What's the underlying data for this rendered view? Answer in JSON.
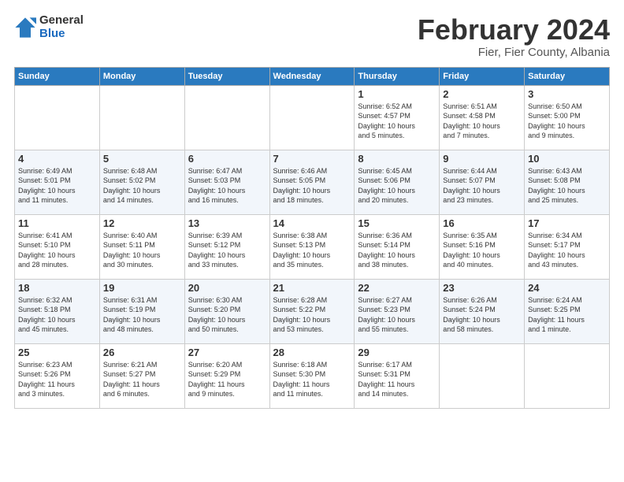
{
  "logo": {
    "general": "General",
    "blue": "Blue"
  },
  "title": "February 2024",
  "subtitle": "Fier, Fier County, Albania",
  "days_of_week": [
    "Sunday",
    "Monday",
    "Tuesday",
    "Wednesday",
    "Thursday",
    "Friday",
    "Saturday"
  ],
  "weeks": [
    [
      {
        "num": "",
        "info": ""
      },
      {
        "num": "",
        "info": ""
      },
      {
        "num": "",
        "info": ""
      },
      {
        "num": "",
        "info": ""
      },
      {
        "num": "1",
        "info": "Sunrise: 6:52 AM\nSunset: 4:57 PM\nDaylight: 10 hours\nand 5 minutes."
      },
      {
        "num": "2",
        "info": "Sunrise: 6:51 AM\nSunset: 4:58 PM\nDaylight: 10 hours\nand 7 minutes."
      },
      {
        "num": "3",
        "info": "Sunrise: 6:50 AM\nSunset: 5:00 PM\nDaylight: 10 hours\nand 9 minutes."
      }
    ],
    [
      {
        "num": "4",
        "info": "Sunrise: 6:49 AM\nSunset: 5:01 PM\nDaylight: 10 hours\nand 11 minutes."
      },
      {
        "num": "5",
        "info": "Sunrise: 6:48 AM\nSunset: 5:02 PM\nDaylight: 10 hours\nand 14 minutes."
      },
      {
        "num": "6",
        "info": "Sunrise: 6:47 AM\nSunset: 5:03 PM\nDaylight: 10 hours\nand 16 minutes."
      },
      {
        "num": "7",
        "info": "Sunrise: 6:46 AM\nSunset: 5:05 PM\nDaylight: 10 hours\nand 18 minutes."
      },
      {
        "num": "8",
        "info": "Sunrise: 6:45 AM\nSunset: 5:06 PM\nDaylight: 10 hours\nand 20 minutes."
      },
      {
        "num": "9",
        "info": "Sunrise: 6:44 AM\nSunset: 5:07 PM\nDaylight: 10 hours\nand 23 minutes."
      },
      {
        "num": "10",
        "info": "Sunrise: 6:43 AM\nSunset: 5:08 PM\nDaylight: 10 hours\nand 25 minutes."
      }
    ],
    [
      {
        "num": "11",
        "info": "Sunrise: 6:41 AM\nSunset: 5:10 PM\nDaylight: 10 hours\nand 28 minutes."
      },
      {
        "num": "12",
        "info": "Sunrise: 6:40 AM\nSunset: 5:11 PM\nDaylight: 10 hours\nand 30 minutes."
      },
      {
        "num": "13",
        "info": "Sunrise: 6:39 AM\nSunset: 5:12 PM\nDaylight: 10 hours\nand 33 minutes."
      },
      {
        "num": "14",
        "info": "Sunrise: 6:38 AM\nSunset: 5:13 PM\nDaylight: 10 hours\nand 35 minutes."
      },
      {
        "num": "15",
        "info": "Sunrise: 6:36 AM\nSunset: 5:14 PM\nDaylight: 10 hours\nand 38 minutes."
      },
      {
        "num": "16",
        "info": "Sunrise: 6:35 AM\nSunset: 5:16 PM\nDaylight: 10 hours\nand 40 minutes."
      },
      {
        "num": "17",
        "info": "Sunrise: 6:34 AM\nSunset: 5:17 PM\nDaylight: 10 hours\nand 43 minutes."
      }
    ],
    [
      {
        "num": "18",
        "info": "Sunrise: 6:32 AM\nSunset: 5:18 PM\nDaylight: 10 hours\nand 45 minutes."
      },
      {
        "num": "19",
        "info": "Sunrise: 6:31 AM\nSunset: 5:19 PM\nDaylight: 10 hours\nand 48 minutes."
      },
      {
        "num": "20",
        "info": "Sunrise: 6:30 AM\nSunset: 5:20 PM\nDaylight: 10 hours\nand 50 minutes."
      },
      {
        "num": "21",
        "info": "Sunrise: 6:28 AM\nSunset: 5:22 PM\nDaylight: 10 hours\nand 53 minutes."
      },
      {
        "num": "22",
        "info": "Sunrise: 6:27 AM\nSunset: 5:23 PM\nDaylight: 10 hours\nand 55 minutes."
      },
      {
        "num": "23",
        "info": "Sunrise: 6:26 AM\nSunset: 5:24 PM\nDaylight: 10 hours\nand 58 minutes."
      },
      {
        "num": "24",
        "info": "Sunrise: 6:24 AM\nSunset: 5:25 PM\nDaylight: 11 hours\nand 1 minute."
      }
    ],
    [
      {
        "num": "25",
        "info": "Sunrise: 6:23 AM\nSunset: 5:26 PM\nDaylight: 11 hours\nand 3 minutes."
      },
      {
        "num": "26",
        "info": "Sunrise: 6:21 AM\nSunset: 5:27 PM\nDaylight: 11 hours\nand 6 minutes."
      },
      {
        "num": "27",
        "info": "Sunrise: 6:20 AM\nSunset: 5:29 PM\nDaylight: 11 hours\nand 9 minutes."
      },
      {
        "num": "28",
        "info": "Sunrise: 6:18 AM\nSunset: 5:30 PM\nDaylight: 11 hours\nand 11 minutes."
      },
      {
        "num": "29",
        "info": "Sunrise: 6:17 AM\nSunset: 5:31 PM\nDaylight: 11 hours\nand 14 minutes."
      },
      {
        "num": "",
        "info": ""
      },
      {
        "num": "",
        "info": ""
      }
    ]
  ]
}
